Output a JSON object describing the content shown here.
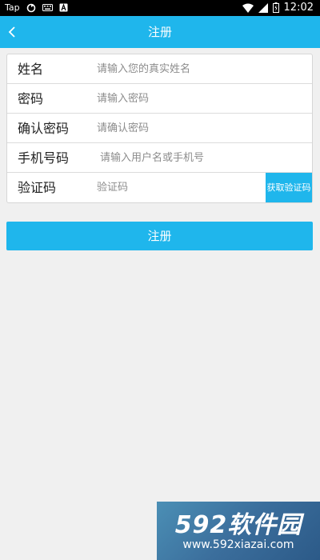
{
  "status_bar": {
    "tap_label": "Tap",
    "time": "12:02"
  },
  "app_bar": {
    "title": "注册"
  },
  "form": {
    "name": {
      "label": "姓名",
      "placeholder": "请输入您的真实姓名"
    },
    "password": {
      "label": "密码",
      "placeholder": "请输入密码"
    },
    "confirm_password": {
      "label": "确认密码",
      "placeholder": "请确认密码"
    },
    "phone": {
      "label": "手机号码",
      "placeholder": "请输入用户名或手机号"
    },
    "code": {
      "label": "验证码",
      "placeholder": "验证码",
      "button": "获取验证码"
    }
  },
  "submit_label": "注册",
  "watermark": {
    "brand": "592软件园",
    "url": "www.592xiazai.com"
  },
  "colors": {
    "accent": "#1fb6ec",
    "background": "#f0f0f0"
  }
}
